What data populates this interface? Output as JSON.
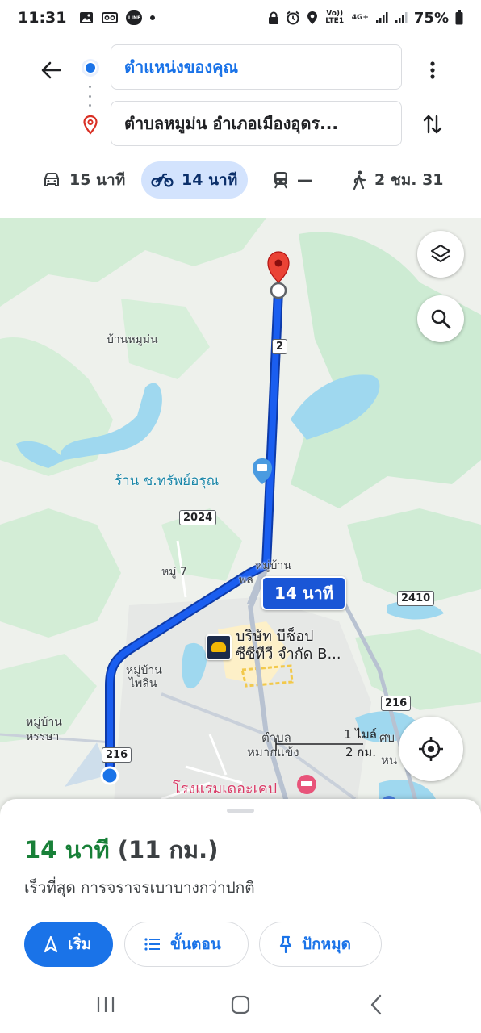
{
  "status_bar": {
    "time": "11:31",
    "line_label": "LINE",
    "volte_label": "Vo)) LTE1",
    "network_label": "4G+",
    "battery": "75%"
  },
  "directions": {
    "origin": "ตำแหน่งของคุณ",
    "destination": "ตำบลหมูม่น อำเภอเมืองอุดร...",
    "modes": [
      {
        "icon": "car-icon",
        "label": "15 นาที",
        "active": false
      },
      {
        "icon": "motorcycle-icon",
        "label": "14 นาที",
        "active": true
      },
      {
        "icon": "transit-icon",
        "label": "—",
        "active": false
      },
      {
        "icon": "walk-icon",
        "label": "2 ชม. 31",
        "active": false
      }
    ]
  },
  "map": {
    "labels": {
      "ban_mu_mon": "บ้านหมูม่น",
      "shop": "ร้าน ช.ทรัพย์อรุณ",
      "moo_7": "หมู่ 7",
      "ban_phai_lom_top": "หมู่บ้าน",
      "ban_phai_lom_top2": "พล",
      "ban_phai_lin_1": "หมู่บ้าน",
      "ban_phai_lin_2": "ไพลิน",
      "ban_hansa_1": "หมู่บ้าน",
      "ban_hansa_2": "หรรษา",
      "tambon_1": "ตำบล",
      "tambon_2": "หมากแข้ง",
      "edge_text_1": "ศบ",
      "edge_text_2": "หน",
      "hotel": "โรงแรมเดอะเคป",
      "company_line1": "บริษัท บีช็อป",
      "company_line2": "ซีซีทีวี จำกัด B...",
      "company_logo_text": "B SHOP"
    },
    "road_shields": [
      "2",
      "2024",
      "2410",
      "216",
      "216"
    ],
    "route_time": "14 นาที",
    "scale": {
      "top": "1 ไมล์",
      "bottom": "2 กม."
    },
    "colors": {
      "route": "#1a5ef0",
      "water": "#9fd8ef",
      "green": "#cfecd5",
      "pin": "#ea4335"
    }
  },
  "sheet": {
    "duration": "14 นาที",
    "distance": "(11 กม.)",
    "note": "เร็วที่สุด การจราจรเบาบางกว่าปกติ",
    "buttons": {
      "start": "เริ่ม",
      "steps": "ขั้นตอน",
      "pin": "ปักหมุด"
    }
  }
}
